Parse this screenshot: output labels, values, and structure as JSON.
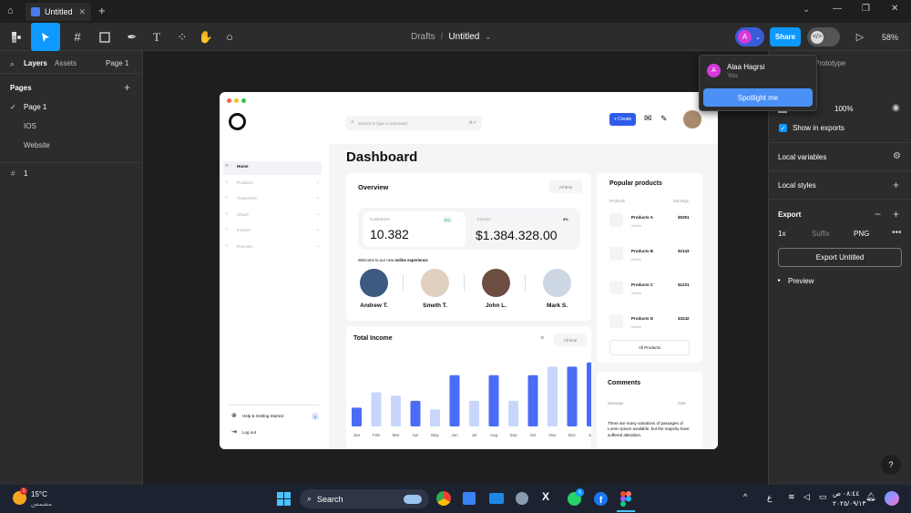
{
  "titlebar": {
    "tab_title": "Untitled",
    "new_tab": "+",
    "min": "—",
    "max": "❐",
    "close": "✕",
    "home_icon": "home-icon",
    "chevron": "⌄"
  },
  "toolbar": {
    "breadcrumb_parent": "Drafts",
    "breadcrumb_sep": "/",
    "file_name": "Untitled",
    "share_label": "Share",
    "zoom": "58%",
    "avatar_letter": "A"
  },
  "left_panel": {
    "tab_layers": "Layers",
    "tab_assets": "Assets",
    "page_selector": "Page 1",
    "pages_heading": "Pages",
    "pages": [
      "Page 1",
      "IOS",
      "Website"
    ],
    "layer_name": "1"
  },
  "popover": {
    "user_name": "Alaa Hagrsi",
    "user_sub": "You",
    "avatar_letter": "A",
    "spotlight_label": "Spotlight me"
  },
  "right_panel": {
    "prototype_tab": "Prototype",
    "opacity": "100%",
    "show_in_exports": "Show in exports",
    "local_variables": "Local variables",
    "local_styles": "Local styles",
    "export_heading": "Export",
    "export_scale": "1x",
    "export_suffix": "Suffix",
    "export_format": "PNG",
    "export_button": "Export Untitled",
    "preview": "Preview",
    "help": "?"
  },
  "dashboard": {
    "search_placeholder": "Search to type a command",
    "search_shortcut": "⌘ F",
    "create_label": "+ Create",
    "nav": [
      "Home",
      "Products",
      "Customers",
      "Shops",
      "Income",
      "Promote"
    ],
    "help_label": "Help & Getting Started",
    "help_badge": "8",
    "logout_label": "Log out",
    "title": "Dashboard",
    "overview_title": "Overview",
    "overview_filter": "All time",
    "stat1_label": "Customers",
    "stat1_value": "10.382",
    "stat1_badge": "8%",
    "stat2_label": "Income",
    "stat2_value": "$1.384.328.00",
    "stat2_badge": "3%",
    "welcome_prefix": "Welcome to our new",
    "welcome_bold": "online experience",
    "people": [
      "Andrew T.",
      "Smeth T.",
      "John L.",
      "Mark S."
    ],
    "income_title": "Total Income",
    "income_filter": "All time",
    "popular_title": "Popular products",
    "col_products": "Products",
    "col_earnings": "Earnings",
    "products": [
      {
        "name": "Products A",
        "status": "Active",
        "price": "$5391"
      },
      {
        "name": "Products B",
        "status": "Active",
        "price": "$2143"
      },
      {
        "name": "Products C",
        "status": "Active",
        "price": "$1231"
      },
      {
        "name": "Products D",
        "status": "Active",
        "price": "$3242"
      }
    ],
    "all_products": "All Products",
    "comments_title": "Comments",
    "col_message": "Message",
    "col_date": "Date",
    "comment_text": "There are many variations of passages of Lorem Ipsum available, but the majority have suffered alteration."
  },
  "chart_data": {
    "type": "bar",
    "categories": [
      "Jan",
      "Feb",
      "Mar",
      "Apr",
      "May",
      "Jun",
      "Jul",
      "Aug",
      "Sep",
      "Oct",
      "Nov",
      "Dec",
      "Jan"
    ],
    "values": [
      22,
      40,
      36,
      30,
      20,
      60,
      30,
      60,
      30,
      60,
      70,
      70,
      75
    ],
    "colors": [
      "#4a6cf7",
      "#c9d6fb",
      "#c9d6fb",
      "#4a6cf7",
      "#c9d6fb",
      "#4a6cf7",
      "#c9d6fb",
      "#4a6cf7",
      "#c9d6fb",
      "#4a6cf7",
      "#c9d6fb",
      "#4a6cf7",
      "#4a6cf7"
    ],
    "ylim": [
      0,
      80
    ]
  },
  "taskbar": {
    "weather_temp": "15°C",
    "weather_desc": "مشمس",
    "search_label": "Search",
    "lang": "ع",
    "time": "٠٨:٤٤ ص",
    "date": "٢٠٢٥/٠٩/١٣",
    "notif_badge": "1",
    "wa_badge": "6"
  },
  "colors": {
    "accent": "#4a6cf7",
    "figma_blue": "#0d99ff"
  }
}
